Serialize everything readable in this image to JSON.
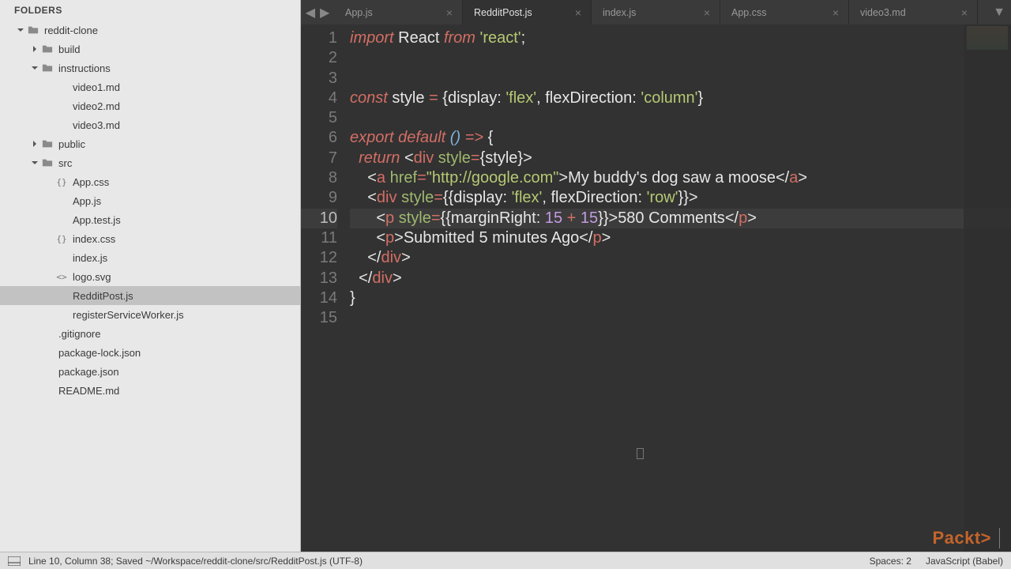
{
  "sidebar": {
    "title": "FOLDERS",
    "tree": [
      {
        "depth": 0,
        "kind": "folder",
        "arrow": "down",
        "label": "reddit-clone"
      },
      {
        "depth": 1,
        "kind": "folder",
        "arrow": "right",
        "label": "build"
      },
      {
        "depth": 1,
        "kind": "folder",
        "arrow": "down",
        "label": "instructions"
      },
      {
        "depth": 2,
        "kind": "file-blank",
        "label": "video1.md"
      },
      {
        "depth": 2,
        "kind": "file-blank",
        "label": "video2.md"
      },
      {
        "depth": 2,
        "kind": "file-blank",
        "label": "video3.md"
      },
      {
        "depth": 1,
        "kind": "folder",
        "arrow": "right",
        "label": "public"
      },
      {
        "depth": 1,
        "kind": "folder",
        "arrow": "down",
        "label": "src"
      },
      {
        "depth": 2,
        "kind": "file-braces",
        "label": "App.css"
      },
      {
        "depth": 2,
        "kind": "file-blank",
        "label": "App.js"
      },
      {
        "depth": 2,
        "kind": "file-blank",
        "label": "App.test.js"
      },
      {
        "depth": 2,
        "kind": "file-braces",
        "label": "index.css"
      },
      {
        "depth": 2,
        "kind": "file-blank",
        "label": "index.js"
      },
      {
        "depth": 2,
        "kind": "file-angle",
        "label": "logo.svg"
      },
      {
        "depth": 2,
        "kind": "file-blank",
        "label": "RedditPost.js",
        "selected": true
      },
      {
        "depth": 2,
        "kind": "file-blank",
        "label": "registerServiceWorker.js"
      },
      {
        "depth": 1,
        "kind": "file-blank",
        "label": ".gitignore"
      },
      {
        "depth": 1,
        "kind": "file-blank",
        "label": "package-lock.json"
      },
      {
        "depth": 1,
        "kind": "file-blank",
        "label": "package.json"
      },
      {
        "depth": 1,
        "kind": "file-blank",
        "label": "README.md"
      }
    ]
  },
  "tabs": [
    {
      "label": "App.js",
      "active": false
    },
    {
      "label": "RedditPost.js",
      "active": true
    },
    {
      "label": "index.js",
      "active": false
    },
    {
      "label": "App.css",
      "active": false
    },
    {
      "label": "video3.md",
      "active": false
    }
  ],
  "code": {
    "highlight_line": 10,
    "lines": [
      [
        {
          "c": "kw",
          "t": "import"
        },
        {
          "c": "txt",
          "t": " React "
        },
        {
          "c": "kw",
          "t": "from"
        },
        {
          "c": "txt",
          "t": " "
        },
        {
          "c": "str",
          "t": "'react'"
        },
        {
          "c": "txt",
          "t": ";"
        }
      ],
      [],
      [],
      [
        {
          "c": "kw2",
          "t": "const"
        },
        {
          "c": "txt",
          "t": " style "
        },
        {
          "c": "op",
          "t": "="
        },
        {
          "c": "txt",
          "t": " {display: "
        },
        {
          "c": "str",
          "t": "'flex'"
        },
        {
          "c": "txt",
          "t": ", flexDirection: "
        },
        {
          "c": "str",
          "t": "'column'"
        },
        {
          "c": "txt",
          "t": "}"
        }
      ],
      [],
      [
        {
          "c": "kw",
          "t": "export"
        },
        {
          "c": "txt",
          "t": " "
        },
        {
          "c": "kw",
          "t": "default"
        },
        {
          "c": "txt",
          "t": " "
        },
        {
          "c": "fn",
          "t": "()"
        },
        {
          "c": "txt",
          "t": " "
        },
        {
          "c": "kw2",
          "t": "=>"
        },
        {
          "c": "txt",
          "t": " {"
        }
      ],
      [
        {
          "c": "txt",
          "t": "  "
        },
        {
          "c": "kw",
          "t": "return"
        },
        {
          "c": "txt",
          "t": " "
        },
        {
          "c": "tagp",
          "t": "<"
        },
        {
          "c": "tagn",
          "t": "div"
        },
        {
          "c": "txt",
          "t": " "
        },
        {
          "c": "attr",
          "t": "style"
        },
        {
          "c": "op",
          "t": "="
        },
        {
          "c": "txt",
          "t": "{style}"
        },
        {
          "c": "tagp",
          "t": ">"
        }
      ],
      [
        {
          "c": "txt",
          "t": "    "
        },
        {
          "c": "tagp",
          "t": "<"
        },
        {
          "c": "tagn",
          "t": "a"
        },
        {
          "c": "txt",
          "t": " "
        },
        {
          "c": "attr",
          "t": "href"
        },
        {
          "c": "op",
          "t": "="
        },
        {
          "c": "str",
          "t": "\"http://google.com\""
        },
        {
          "c": "tagp",
          "t": ">"
        },
        {
          "c": "txt",
          "t": "My buddy's dog saw a moose"
        },
        {
          "c": "tagp",
          "t": "</"
        },
        {
          "c": "tagn",
          "t": "a"
        },
        {
          "c": "tagp",
          "t": ">"
        }
      ],
      [
        {
          "c": "txt",
          "t": "    "
        },
        {
          "c": "tagp",
          "t": "<"
        },
        {
          "c": "tagn",
          "t": "div"
        },
        {
          "c": "txt",
          "t": " "
        },
        {
          "c": "attr",
          "t": "style"
        },
        {
          "c": "op",
          "t": "="
        },
        {
          "c": "txt",
          "t": "{{display: "
        },
        {
          "c": "str",
          "t": "'flex'"
        },
        {
          "c": "txt",
          "t": ", flexDirection: "
        },
        {
          "c": "str",
          "t": "'row'"
        },
        {
          "c": "txt",
          "t": "}}"
        },
        {
          "c": "tagp",
          "t": ">"
        }
      ],
      [
        {
          "c": "txt",
          "t": "      "
        },
        {
          "c": "tagp",
          "t": "<"
        },
        {
          "c": "tagn",
          "t": "p"
        },
        {
          "c": "txt",
          "t": " "
        },
        {
          "c": "attr",
          "t": "style"
        },
        {
          "c": "op",
          "t": "="
        },
        {
          "c": "txt",
          "t": "{{marginRight: "
        },
        {
          "c": "num",
          "t": "15"
        },
        {
          "c": "txt",
          "t": " "
        },
        {
          "c": "op",
          "t": "+"
        },
        {
          "c": "txt",
          "t": " "
        },
        {
          "c": "num",
          "t": "15"
        },
        {
          "c": "txt",
          "t": "}}"
        },
        {
          "c": "tagp",
          "t": ">"
        },
        {
          "c": "txt",
          "t": "580 Comments"
        },
        {
          "c": "tagp",
          "t": "</"
        },
        {
          "c": "tagn",
          "t": "p"
        },
        {
          "c": "tagp",
          "t": ">"
        }
      ],
      [
        {
          "c": "txt",
          "t": "      "
        },
        {
          "c": "tagp",
          "t": "<"
        },
        {
          "c": "tagn",
          "t": "p"
        },
        {
          "c": "tagp",
          "t": ">"
        },
        {
          "c": "txt",
          "t": "Submitted 5 minutes Ago"
        },
        {
          "c": "tagp",
          "t": "</"
        },
        {
          "c": "tagn",
          "t": "p"
        },
        {
          "c": "tagp",
          "t": ">"
        }
      ],
      [
        {
          "c": "txt",
          "t": "    "
        },
        {
          "c": "tagp",
          "t": "</"
        },
        {
          "c": "tagn",
          "t": "div"
        },
        {
          "c": "tagp",
          "t": ">"
        }
      ],
      [
        {
          "c": "txt",
          "t": "  "
        },
        {
          "c": "tagp",
          "t": "</"
        },
        {
          "c": "tagn",
          "t": "div"
        },
        {
          "c": "tagp",
          "t": ">"
        }
      ],
      [
        {
          "c": "txt",
          "t": "}"
        }
      ],
      []
    ]
  },
  "status": {
    "position": "Line 10, Column 38; Saved ~/Workspace/reddit-clone/src/RedditPost.js (UTF-8)",
    "spaces": "Spaces: 2",
    "lang": "JavaScript (Babel)"
  },
  "brand": "Packt>"
}
